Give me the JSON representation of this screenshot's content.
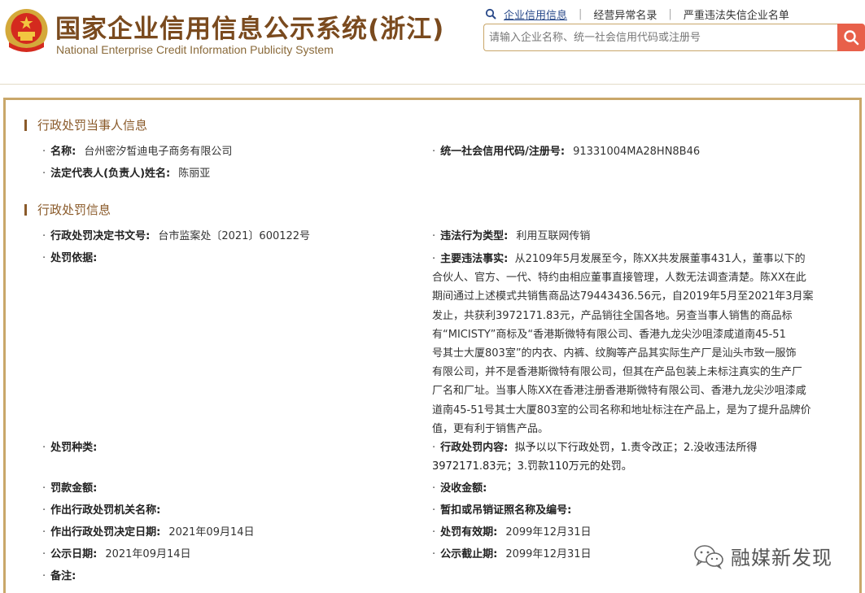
{
  "header": {
    "title_cn": "国家企业信用信息公示系统(浙江)",
    "title_en": "National Enterprise Credit Information Publicity System",
    "nav": [
      {
        "label": "企业信用信息"
      },
      {
        "label": "经营异常名录"
      },
      {
        "label": "严重违法失信企业名单"
      }
    ],
    "search_placeholder": "请输入企业名称、统一社会信用代码或注册号"
  },
  "party_section": {
    "title": "行政处罚当事人信息",
    "name_label": "名称:",
    "name_value": "台州密汐皙迪电子商务有限公司",
    "code_label": "统一社会信用代码/注册号:",
    "code_value": "91331004MA28HN8B46",
    "rep_label": "法定代表人(负责人)姓名:",
    "rep_value": "陈丽亚"
  },
  "penalty_section": {
    "title": "行政处罚信息",
    "doc_no_label": "行政处罚决定书文号:",
    "doc_no_value": "台市监案处〔2021〕600122号",
    "type_label": "违法行为类型:",
    "type_value": "利用互联网传销",
    "basis_label": "处罚依据:",
    "facts_label": "主要违法事实:",
    "facts_lines": [
      "从2109年5月发展至今，陈XX共发展董事431人，董事以下的",
      "合伙人、官方、一代、特约由相应董事直接管理，人数无法调查清楚。陈XX在此",
      "期间通过上述模式共销售商品达79443436.56元，自2019年5月至2021年3月案",
      "发止，共获利3972171.83元，产品销往全国各地。另查当事人销售的商品标",
      "有“MICISTY”商标及“香港斯微特有限公司、香港九龙尖沙咀漆咸道南45-51",
      "号其士大厦803室”的内衣、内裤、纹胸等产品其实际生产厂是汕头市致一服饰",
      "有限公司，并不是香港斯微特有限公司，但其在产品包装上未标注真实的生产厂",
      "厂名和厂址。当事人陈XX在香港注册香港斯微特有限公司、香港九龙尖沙咀漆咸",
      "道南45-51号其士大厦803室的公司名称和地址标注在产品上，是为了提升品牌价",
      "值，更有利于销售产品。"
    ],
    "category_label": "处罚种类:",
    "content_label": "行政处罚内容:",
    "content_lines": [
      "拟予以以下行政处罚，1.责令改正；2.没收违法所得",
      "3972171.83元；3.罚款110万元的处罚。"
    ],
    "fine_label": "罚款金额:",
    "confiscate_label": "没收金额:",
    "authority_label": "作出行政处罚机关名称:",
    "license_label": "暂扣或吊销证照名称及编号:",
    "decision_date_label": "作出行政处罚决定日期:",
    "decision_date_value": "2021年09月14日",
    "valid_label": "处罚有效期:",
    "valid_value": "2099年12月31日",
    "publish_date_label": "公示日期:",
    "publish_date_value": "2021年09月14日",
    "publish_end_label": "公示截止期:",
    "publish_end_value": "2099年12月31日",
    "remark_label": "备注:"
  },
  "watermark": {
    "text": "融媒新发现",
    "icon": "wechat-icon"
  },
  "colors": {
    "accent_gold": "#c9a76a",
    "title_brown": "#7a4a1e",
    "search_red": "#e8604a"
  }
}
